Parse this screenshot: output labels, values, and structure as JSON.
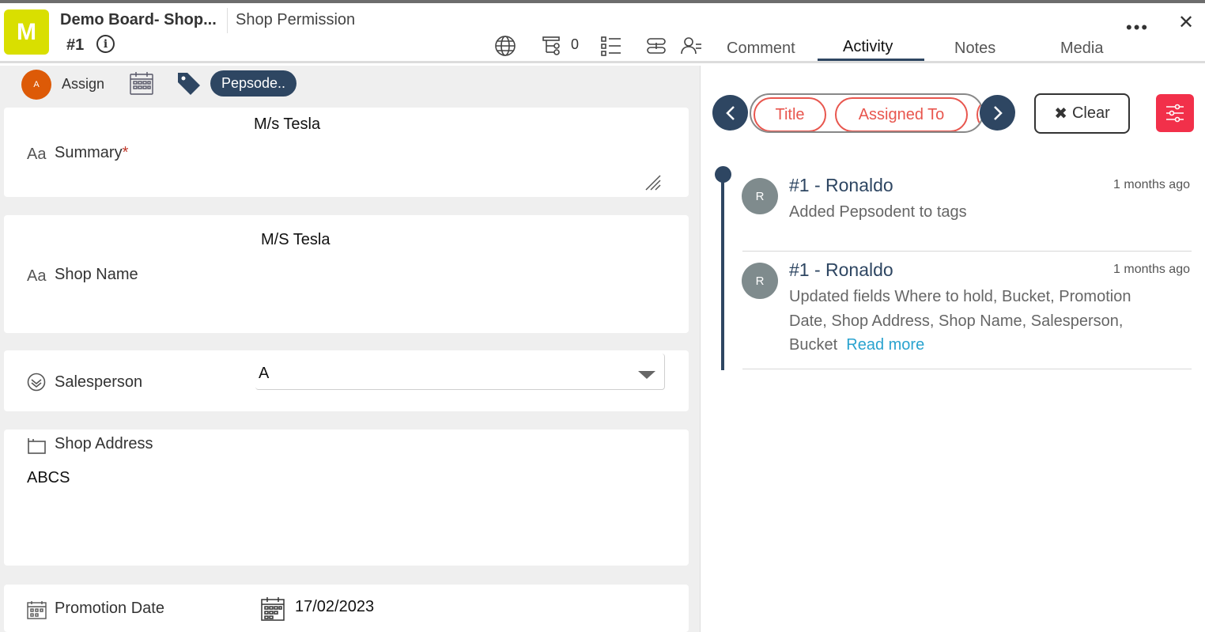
{
  "header": {
    "logo_letter": "M",
    "title": "Demo Board- Shop...",
    "subtitle": "Shop Permission",
    "card_id": "#1",
    "info_icon": "i",
    "subtask_count": "0",
    "more": "•••",
    "close": "✕",
    "icons": [
      "globe-icon",
      "subtask-icon",
      "checklist-icon",
      "link-icon",
      "watchers-icon",
      "info-icon",
      "more-icon",
      "close-icon"
    ]
  },
  "tabs": [
    {
      "label": "Comment"
    },
    {
      "label": "Activity",
      "active": true
    },
    {
      "label": "Notes"
    },
    {
      "label": "Media"
    }
  ],
  "toolbar": {
    "assign_avatar": "A",
    "assign_label": "Assign",
    "tag_label": "Pepsode.."
  },
  "fields": {
    "summary": {
      "label": "Summary",
      "required_mark": "*",
      "value": "M/s Tesla",
      "icon": "Aa"
    },
    "shop_name": {
      "label": "Shop Name",
      "value": "M/S Tesla",
      "icon": "Aa"
    },
    "salesperson": {
      "label": "Salesperson",
      "value": "A"
    },
    "shop_address": {
      "label": "Shop Address",
      "value": "ABCS"
    },
    "promotion_date": {
      "label": "Promotion Date",
      "value": "17/02/2023"
    }
  },
  "filters": {
    "chips": [
      "Title",
      "Assigned To"
    ],
    "clear_label": "Clear",
    "clear_icon": "✖"
  },
  "activity": [
    {
      "avatar": "R",
      "title": "#1 - Ronaldo",
      "time": "1 months ago",
      "desc": "Added Pepsodent to tags",
      "read_more": ""
    },
    {
      "avatar": "R",
      "title": "#1 - Ronaldo",
      "time": "1 months ago",
      "desc": "Updated fields Where to hold, Bucket, Promotion Date, Shop Address, Shop Name, Salesperson, Bucket",
      "read_more": "Read more"
    }
  ],
  "colors": {
    "accent": "#2e4662",
    "logo": "#d9df00",
    "chip": "#e8564e",
    "filter_button": "#f2304a",
    "assign_avatar": "#dd5a07",
    "link": "#2aa3cf"
  }
}
